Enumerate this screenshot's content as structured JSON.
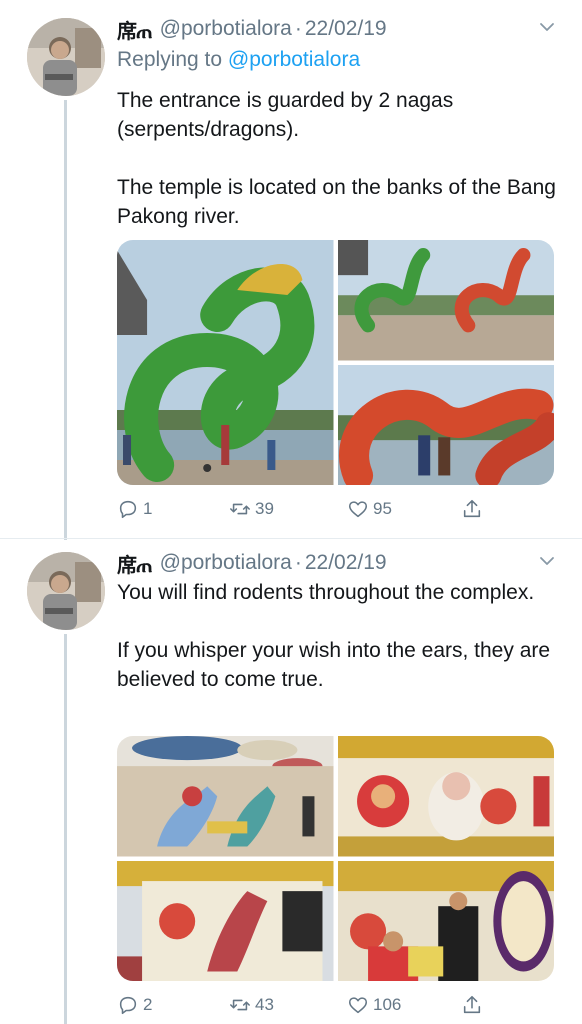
{
  "tweets": [
    {
      "name_glyph": "席ጠ",
      "handle": "@porbotialora",
      "dot": "·",
      "date": "22/02/19",
      "reply_prefix": "Replying to",
      "reply_mention": "@porbotialora",
      "para1": "The entrance is guarded by 2 nagas (serpents/dragons).",
      "para2": "The temple is located on the banks of the Bang Pakong river.",
      "replies": "1",
      "retweets": "39",
      "likes": "95"
    },
    {
      "name_glyph": "席ጠ",
      "handle": "@porbotialora",
      "dot": "·",
      "date": "22/02/19",
      "para1": "You will find rodents throughout the complex.",
      "para2": "If you whisper your wish into the ears, they are believed to come true.",
      "replies": "2",
      "retweets": "43",
      "likes": "106"
    }
  ],
  "icons": {
    "reply": "reply-icon",
    "retweet": "retweet-icon",
    "like": "heart-icon",
    "share": "share-icon",
    "more": "chevron-down-icon"
  },
  "colors": {
    "link": "#1da1f2",
    "secondary": "#657786",
    "thread_line": "#ccd6dd"
  }
}
